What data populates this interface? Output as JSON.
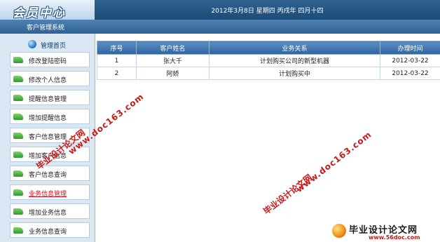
{
  "header": {
    "logo_text": "会员中心",
    "date_text": "2012年3月8日 星期四 丙戌年 四月十四",
    "system_title": "客户管理系统"
  },
  "sidebar": {
    "home_label": "管理首页",
    "items": [
      {
        "label": "修改登陆密码",
        "icon": "arrow-icon",
        "active": false
      },
      {
        "label": "修改个人信息",
        "icon": "arrow-icon",
        "active": false
      },
      {
        "label": "提醒信息管理",
        "icon": "arrow-icon",
        "active": false
      },
      {
        "label": "增加提醒信息",
        "icon": "arrow-icon",
        "active": false
      },
      {
        "label": "客户信息管理",
        "icon": "arrow-icon",
        "active": false
      },
      {
        "label": "增加客户信息",
        "icon": "arrow-icon",
        "active": false
      },
      {
        "label": "客户信息查询",
        "icon": "arrow-icon",
        "active": false
      },
      {
        "label": "业务信息管理",
        "icon": "arrow-icon",
        "active": true
      },
      {
        "label": "增加业务信息",
        "icon": "arrow-icon",
        "active": false
      },
      {
        "label": "业务信息查询",
        "icon": "arrow-icon",
        "active": false
      }
    ]
  },
  "table": {
    "columns": [
      "序号",
      "客户姓名",
      "业务关系",
      "办理时间"
    ],
    "rows": [
      {
        "no": "1",
        "name": "张大千",
        "relation": "计划购买公司的新型机器",
        "date": "2012-03-22"
      },
      {
        "no": "2",
        "name": "阿娇",
        "relation": "计划购买中",
        "date": "2012-03-22"
      }
    ]
  },
  "watermarks": {
    "site_name": "毕业设计论文网",
    "site_url": "www.doc163.com"
  },
  "brand": {
    "name": "毕业设计论文网",
    "url": "www.56doc.com"
  },
  "colors": {
    "header_blue": "#1c4b77",
    "active_red": "#d0121b",
    "watermark_red": "#c81818"
  }
}
